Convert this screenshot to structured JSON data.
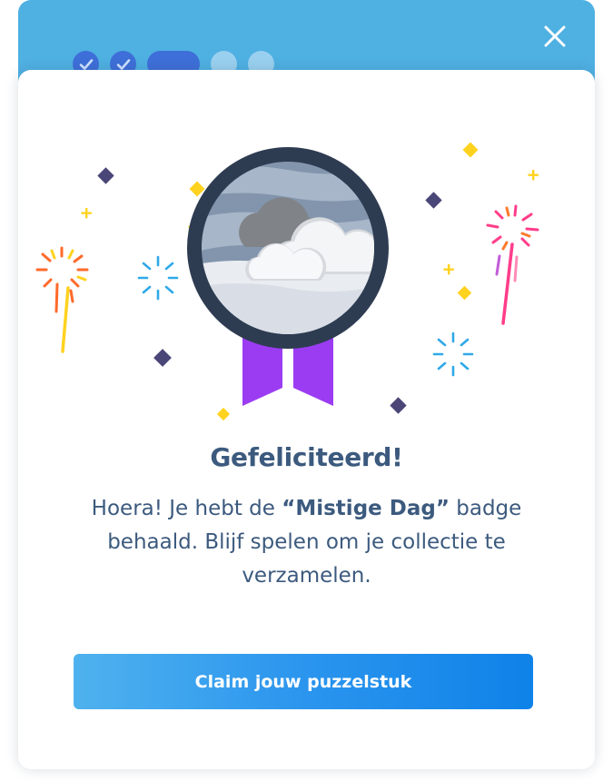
{
  "header": {
    "close_icon": "close-icon",
    "progress_steps": [
      {
        "state": "done",
        "icon": "check-icon"
      },
      {
        "state": "done",
        "icon": "check-icon"
      },
      {
        "state": "active",
        "icon": ""
      },
      {
        "state": "todo",
        "icon": ""
      },
      {
        "state": "todo",
        "icon": ""
      }
    ]
  },
  "badge": {
    "icon": "cloud-badge-icon",
    "ribbon_color": "#9b3cf2",
    "rim_color": "#2e3c52"
  },
  "modal": {
    "title": "Gefeliciteerd!",
    "message_before": "Hoera! Je hebt de ",
    "badge_name": "“Mistige Dag”",
    "message_after": " badge behaald. Blijf spelen om je collectie te verzamelen.",
    "cta_label": "Claim jouw puzzelstuk"
  },
  "colors": {
    "header": "#4fb0e2",
    "text": "#3c5a7e",
    "cta_start": "#4fb2ee",
    "cta_end": "#0f82e8",
    "sparkle_gold": "#ffd21f",
    "sparkle_dark": "#4a4678",
    "firework_blue": "#2fa9e8",
    "firework_orange": "#ff6a2b",
    "firework_pink": "#ff3d8a"
  }
}
